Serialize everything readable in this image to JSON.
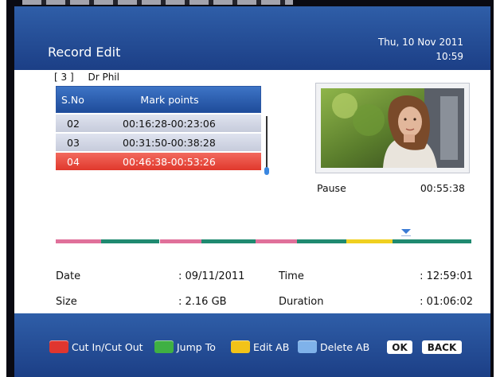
{
  "header": {
    "title": "Record Edit",
    "date": "Thu, 10 Nov 2011",
    "time": "10:59"
  },
  "channel": {
    "number": "[ 3 ]",
    "name": "Dr Phil"
  },
  "mark_list": {
    "col_sno": "S.No",
    "col_marks": "Mark points",
    "rows": [
      {
        "sno": "02",
        "marks": "00:16:28-00:23:06",
        "selected": false
      },
      {
        "sno": "03",
        "marks": "00:31:50-00:38:28",
        "selected": false
      },
      {
        "sno": "04",
        "marks": "00:46:38-00:53:26",
        "selected": true
      }
    ]
  },
  "preview": {
    "state": "Pause",
    "position": "00:55:38"
  },
  "timeline": {
    "segments": [
      {
        "color": "#1f8a70",
        "from": 0,
        "to": 0.0
      },
      {
        "color": "#e0709a",
        "from": 0.0,
        "to": 0.11
      },
      {
        "color": "#1f8a70",
        "from": 0.11,
        "to": 0.25
      },
      {
        "color": "#e0709a",
        "from": 0.25,
        "to": 0.35
      },
      {
        "color": "#1f8a70",
        "from": 0.35,
        "to": 0.48
      },
      {
        "color": "#e0709a",
        "from": 0.48,
        "to": 0.58
      },
      {
        "color": "#1f8a70",
        "from": 0.58,
        "to": 0.7
      },
      {
        "color": "#f0d020",
        "from": 0.7,
        "to": 0.81
      },
      {
        "color": "#1f8a70",
        "from": 0.81,
        "to": 1.0
      }
    ]
  },
  "info": {
    "date_label": "Date",
    "date_value": ": 09/11/2011",
    "time_label": "Time",
    "time_value": ": 12:59:01",
    "size_label": "Size",
    "size_value": ": 2.16 GB",
    "duration_label": "Duration",
    "duration_value": ": 01:06:02"
  },
  "footer": {
    "red_label": "Cut In/Cut Out",
    "green_label": "Jump To",
    "yellow_label": "Edit AB",
    "blue_label": "Delete AB",
    "ok_label": "OK",
    "back_label": "BACK"
  },
  "colors": {
    "red": "#e0362f",
    "green": "#3fb043",
    "yellow": "#f2c318",
    "blue": "#7fb2ea",
    "accent": "#2a5aa8"
  }
}
